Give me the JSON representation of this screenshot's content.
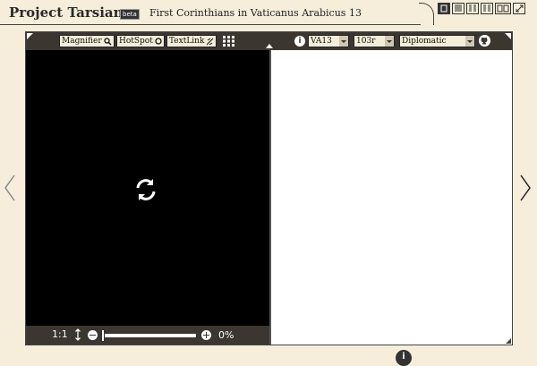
{
  "header": {
    "brand": "Project Tarsian",
    "beta_badge": "beta",
    "document_title": "First Corinthians in Vaticanus Arabicus 13"
  },
  "view_buttons": [
    {
      "icon": "single-page-icon",
      "active": true
    },
    {
      "icon": "text-page-icon",
      "active": false
    },
    {
      "icon": "split-view-icon",
      "active": false
    },
    {
      "icon": "double-view-icon",
      "active": false
    },
    {
      "icon": "book-icon",
      "active": false
    },
    {
      "icon": "fullscreen-icon",
      "active": false
    }
  ],
  "toolbar": {
    "magnifier_label": "Magnifier",
    "hotspot_label": "HotSpot",
    "textlink_label": "TextLink",
    "manuscript_select": "VA13",
    "folio_select": "103r",
    "transcription_select": "Diplomatic"
  },
  "image_viewer": {
    "status_icon": "loading-spinner-icon",
    "ratio_label": "1:1",
    "zoom_percent": "0%",
    "zoom_value": 0
  },
  "colors": {
    "background": "#f6eedb",
    "toolbar": "#3c3631",
    "image_pane": "#000000",
    "text_pane": "#ffffff"
  }
}
